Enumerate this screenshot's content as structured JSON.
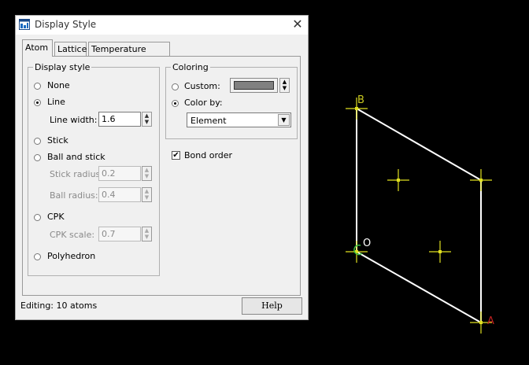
{
  "dialog": {
    "title": "Display Style",
    "close_label": "✕",
    "tabs": [
      "Atom",
      "Lattice",
      "Temperature Factor"
    ],
    "display_style": {
      "legend": "Display style",
      "none": "None",
      "line": "Line",
      "line_width_label": "Line width:",
      "line_width": "1.6",
      "stick": "Stick",
      "ball_and_stick": "Ball and stick",
      "stick_radius_label": "Stick radius:",
      "stick_radius": "0.2",
      "ball_radius_label": "Ball radius:",
      "ball_radius": "0.4",
      "cpk": "CPK",
      "cpk_scale_label": "CPK scale:",
      "cpk_scale": "0.7",
      "polyhedron": "Polyhedron",
      "selected": "Line"
    },
    "coloring": {
      "legend": "Coloring",
      "custom": "Custom:",
      "custom_color": "#808080",
      "color_by": "Color by:",
      "color_by_value": "Element",
      "selected": "Color by:"
    },
    "bond_order": {
      "label": "Bond order",
      "checked": true
    },
    "status": "Editing: 10 atoms",
    "help_label": "Help"
  },
  "viewer": {
    "labels": {
      "b": "B",
      "o": "O",
      "a": "A"
    },
    "colors": {
      "background": "#000000",
      "cell": "#ffffff",
      "atom": "#e0e020",
      "b": "#c8c820",
      "o": "#40c040",
      "a": "#c02020"
    }
  }
}
